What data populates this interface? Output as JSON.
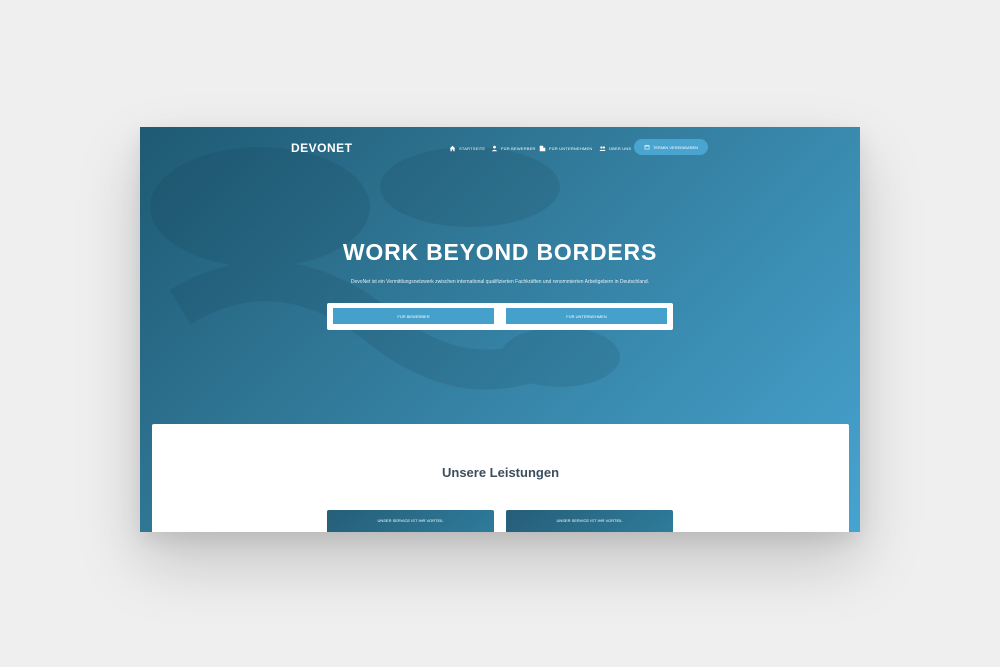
{
  "nav": {
    "logo": "DEVONET",
    "items": [
      {
        "label": "Startseite",
        "icon": "home-icon"
      },
      {
        "label": "Für Bewerber",
        "icon": "person-icon"
      },
      {
        "label": "Für Unternehmen",
        "icon": "building-icon"
      },
      {
        "label": "Über uns",
        "icon": "group-icon"
      }
    ],
    "cta": {
      "label": "Termin vereinbaren",
      "icon": "calendar-icon"
    }
  },
  "hero": {
    "title": "WORK BEYOND BORDERS",
    "subtitle": "DevoNet ist ein Vermittlungsnetzwerk zwischen international qualifizierten Fachkräften und renommierten Arbeitgebern in Deutschland.",
    "buttons": [
      "Für Bewerber",
      "Für Unternehmen"
    ]
  },
  "services": {
    "title": "Unsere Leistungen",
    "cards": [
      {
        "label": "Unser Service ist Ihr Vorteil"
      },
      {
        "label": "Unser Service ist Ihr Vorteil"
      }
    ]
  },
  "colors": {
    "page_background": "#efefef",
    "hero_gradient_start": "#1e5a73",
    "hero_gradient_end": "#46a3cf",
    "accent": "#46a0cc",
    "heading_text": "#3d4d5e"
  }
}
